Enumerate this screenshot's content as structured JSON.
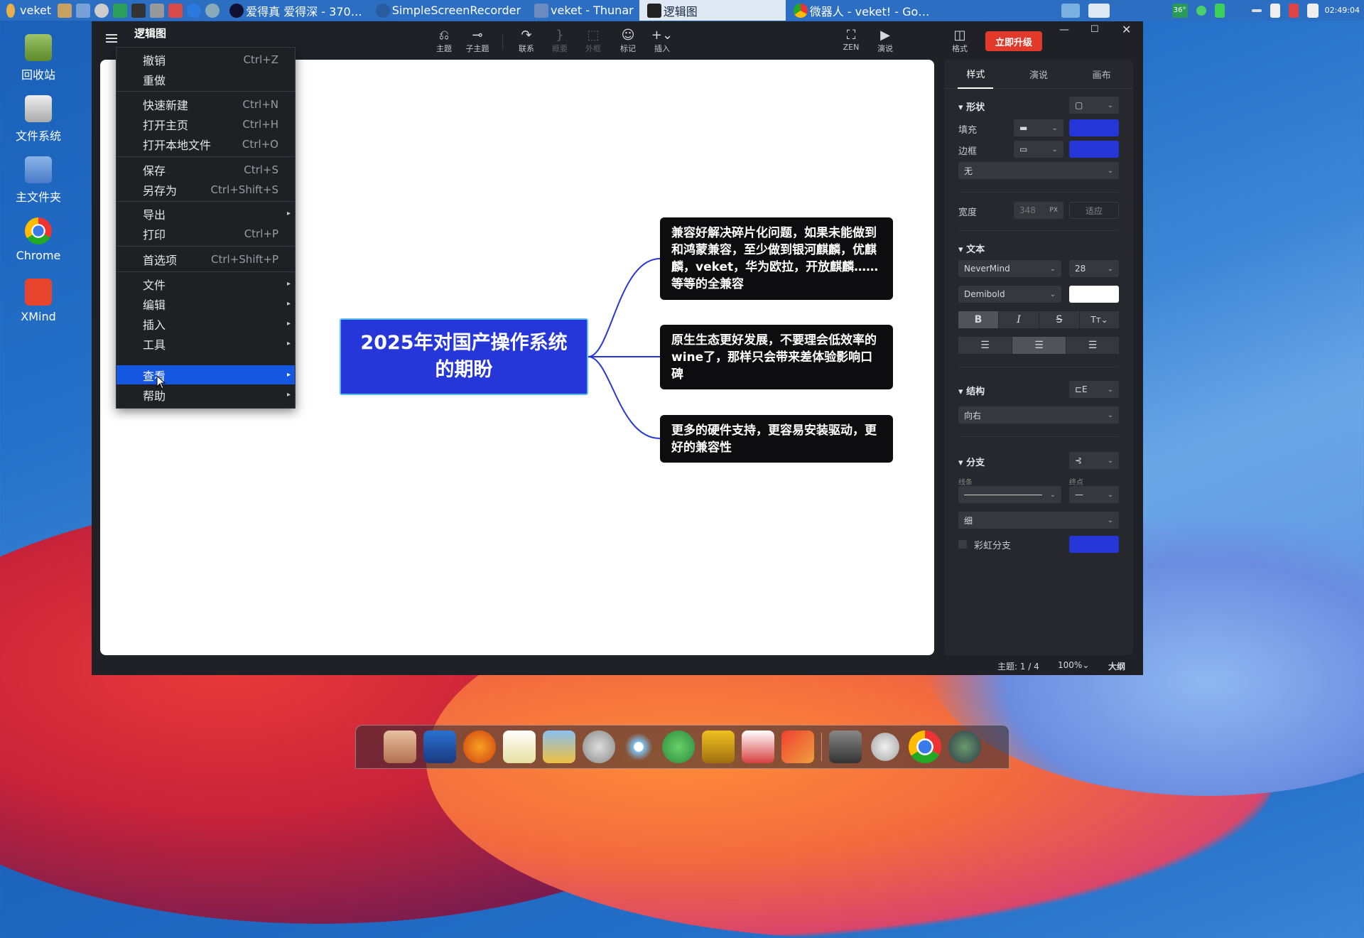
{
  "taskbar": {
    "start_label": "veket",
    "tasks": [
      "爱得真 爱得深 - 370…",
      "SimpleScreenRecorder",
      "veket - Thunar",
      "逻辑图",
      "微器人 - veket! - Go…"
    ],
    "clock": "02:49:04",
    "temp": "36°"
  },
  "desktop_icons": [
    "回收站",
    "文件系统",
    "主文件夹",
    "Chrome",
    "XMind"
  ],
  "window": {
    "title": "逻辑图",
    "upgrade_button": "立即升级",
    "format_label": "格式",
    "toolbar": [
      {
        "label": "主题",
        "icon": "topic-icon"
      },
      {
        "label": "子主题",
        "icon": "subtopic-icon"
      },
      {
        "label": "联系",
        "icon": "relationship-icon"
      },
      {
        "label": "概要",
        "icon": "summary-icon"
      },
      {
        "label": "外框",
        "icon": "boundary-icon"
      },
      {
        "label": "标记",
        "icon": "marker-icon"
      },
      {
        "label": "插入",
        "icon": "insert-icon"
      },
      {
        "label": "ZEN",
        "icon": "zen-icon"
      },
      {
        "label": "演说",
        "icon": "pitch-icon"
      }
    ]
  },
  "menu": {
    "items": [
      {
        "label": "撤销",
        "shortcut": "Ctrl+Z"
      },
      {
        "label": "重做",
        "shortcut": ""
      },
      {
        "label": "快速新建",
        "shortcut": "Ctrl+N"
      },
      {
        "label": "打开主页",
        "shortcut": "Ctrl+H"
      },
      {
        "label": "打开本地文件",
        "shortcut": "Ctrl+O"
      },
      {
        "label": "保存",
        "shortcut": "Ctrl+S"
      },
      {
        "label": "另存为",
        "shortcut": "Ctrl+Shift+S"
      },
      {
        "label": "导出",
        "shortcut": ""
      },
      {
        "label": "打印",
        "shortcut": "Ctrl+P"
      },
      {
        "label": "首选项",
        "shortcut": "Ctrl+Shift+P"
      },
      {
        "label": "文件",
        "shortcut": ""
      },
      {
        "label": "编辑",
        "shortcut": ""
      },
      {
        "label": "插入",
        "shortcut": ""
      },
      {
        "label": "工具",
        "shortcut": ""
      },
      {
        "label": "查看",
        "shortcut": ""
      },
      {
        "label": "帮助",
        "shortcut": ""
      }
    ]
  },
  "mindmap": {
    "central": "2025年对国产操作系统的期盼",
    "branches": [
      "兼容好解决碎片化问题，如果未能做到和鸿蒙兼容，至少做到银河麒麟，优麒麟，veket，华为欧拉，开放麒麟……等等的全兼容",
      "原生生态更好发展，不要理会低效率的wine了，那样只会带来差体验影响口碑",
      "更多的硬件支持，更容易安装驱动，更好的兼容性"
    ]
  },
  "panel": {
    "tabs": [
      "样式",
      "演说",
      "画布"
    ],
    "shape_section": "形状",
    "fill_label": "填充",
    "border_label": "边框",
    "border_style": "无",
    "width_label": "宽度",
    "width_value": "348",
    "width_unit": "PX",
    "fit_label": "适应",
    "text_section": "文本",
    "font_family": "NeverMind",
    "font_size": "28",
    "font_weight": "Demibold",
    "structure_section": "结构",
    "structure_value": "向右",
    "branch_section": "分支",
    "line_label": "线条",
    "endpoint_label": "终点",
    "thickness_value": "细",
    "rainbow_label": "彩虹分支",
    "colors": {
      "fill": "#2637d9",
      "border": "#2637d9",
      "text": "#ffffff",
      "branch": "#2637d9"
    }
  },
  "status": {
    "topic_count": "主题: 1 / 4",
    "zoom": "100%",
    "outline": "大纲"
  }
}
